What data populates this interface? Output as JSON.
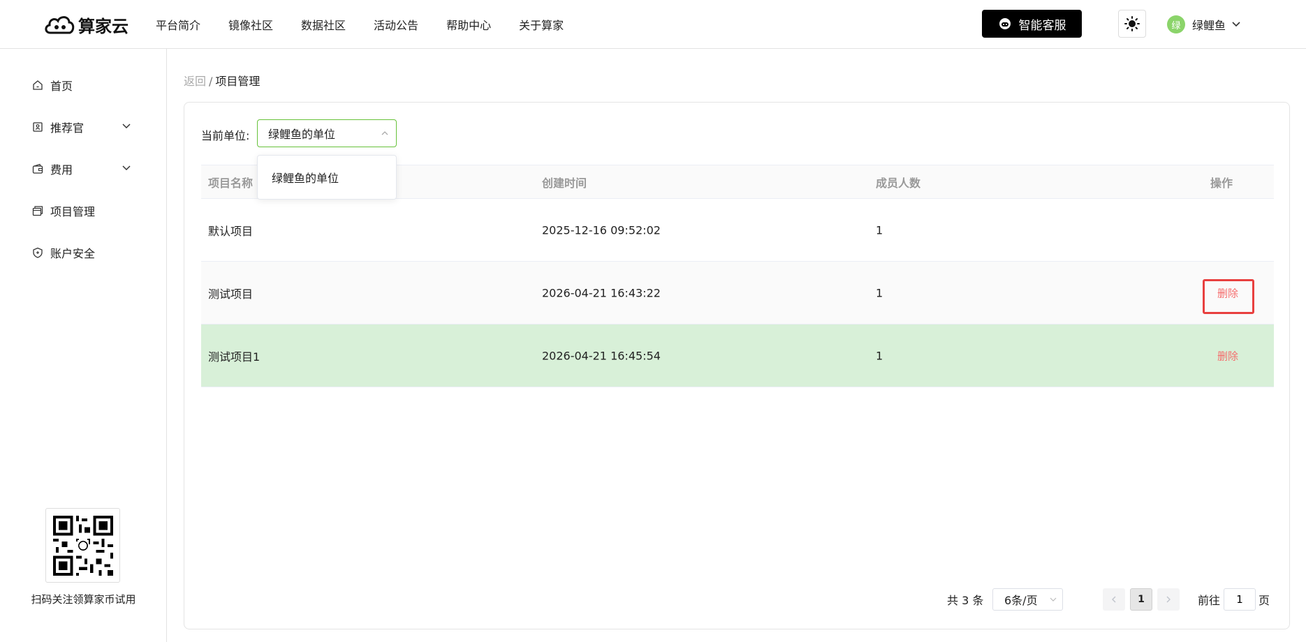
{
  "header": {
    "logo_text": "算家云",
    "nav": [
      "平台简介",
      "镜像社区",
      "数据社区",
      "活动公告",
      "帮助中心",
      "关于算家"
    ],
    "service_label": "智能客服",
    "user": {
      "avatar_text": "绿",
      "name": "绿鲤鱼"
    }
  },
  "sidebar": {
    "items": [
      {
        "label": "首页",
        "icon": "home-icon",
        "expandable": false
      },
      {
        "label": "推荐官",
        "icon": "badge-icon",
        "expandable": true
      },
      {
        "label": "费用",
        "icon": "wallet-icon",
        "expandable": true
      },
      {
        "label": "项目管理",
        "icon": "folder-icon",
        "expandable": false
      },
      {
        "label": "账户安全",
        "icon": "shield-icon",
        "expandable": false
      }
    ],
    "qr_caption": "扫码关注领算家币试用"
  },
  "breadcrumb": {
    "back": "返回",
    "separator": "/",
    "current": "项目管理"
  },
  "unit": {
    "label": "当前单位:",
    "selected": "绿鲤鱼的单位",
    "options": [
      "绿鲤鱼的单位"
    ]
  },
  "table": {
    "columns": [
      "项目名称",
      "创建时间",
      "成员人数",
      "操作"
    ],
    "rows": [
      {
        "name": "默认项目",
        "created": "2025-12-16 09:52:02",
        "members": "1",
        "action": ""
      },
      {
        "name": "测试项目",
        "created": "2026-04-21 16:43:22",
        "members": "1",
        "action": "删除"
      },
      {
        "name": "测试项目1",
        "created": "2026-04-21 16:45:54",
        "members": "1",
        "action": "删除"
      }
    ]
  },
  "pagination": {
    "total": "共 3 条",
    "page_size": "6条/页",
    "current_page": "1",
    "goto_prefix": "前往",
    "goto_value": "1",
    "goto_suffix": "页"
  },
  "colors": {
    "accent": "#67c23a",
    "danger": "#f56c6c",
    "row_hover": "#d8f0d8",
    "highlight": "#e8403f"
  }
}
